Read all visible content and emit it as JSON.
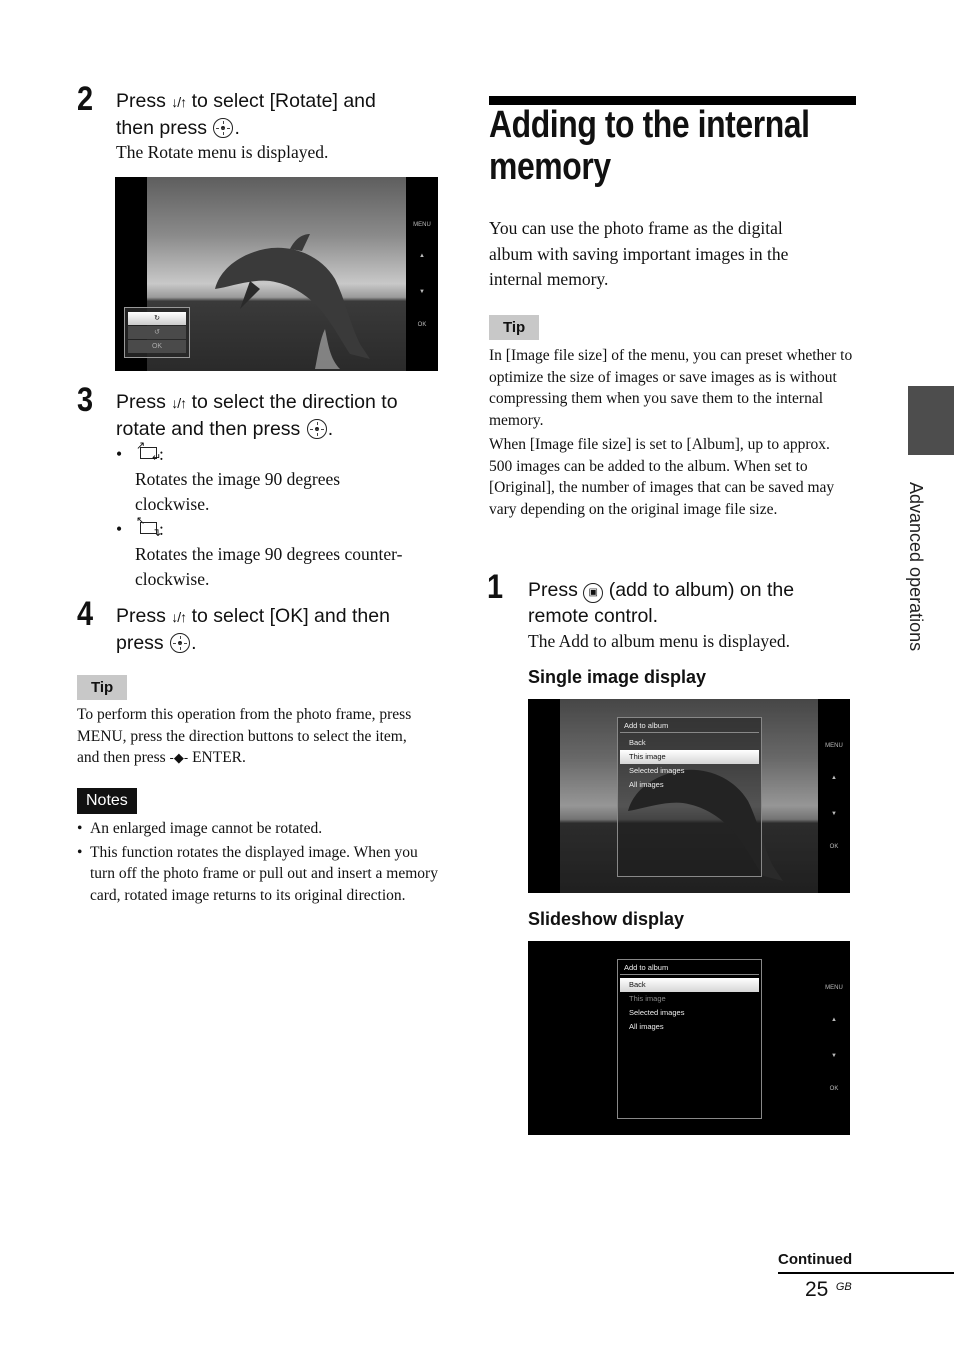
{
  "left_column": {
    "step2": {
      "number": "2",
      "text_before": "Press",
      "arrows": "↓/↑",
      "text_middle": "to select [Rotate] and",
      "line2": "then press",
      "suffix": ".",
      "desc": "The Rotate menu is displayed."
    },
    "rotate_screen": {
      "menu_items": [
        "",
        "",
        "OK"
      ],
      "side_controls": [
        "MENU",
        "▲",
        "▼",
        "OK"
      ]
    },
    "step3": {
      "number": "3",
      "text_before": "Press",
      "arrows": "↓/↑",
      "text_middle": "to select the direction to",
      "line2": "rotate and then press",
      "suffix": ".",
      "bullets": [
        {
          "icon": "rotate-clockwise",
          "colon": ":",
          "desc1": "Rotates the image 90 degrees",
          "desc2": "clockwise."
        },
        {
          "icon": "rotate-counterclockwise",
          "colon": ":",
          "desc1": "Rotates the image 90 degrees counter-",
          "desc2": "clockwise."
        }
      ]
    },
    "step4": {
      "number": "4",
      "text_before": "Press",
      "arrows": "↓/↑",
      "text_middle": "to select [OK] and then",
      "line2": "press",
      "suffix": "."
    },
    "tip": {
      "label": "Tip",
      "line1": "To perform this operation from the photo frame, press",
      "line2": "MENU, press the direction buttons to select the item,",
      "line3_before": "and then press",
      "line3_after": "ENTER."
    },
    "notes": {
      "label": "Notes",
      "items": [
        "An enlarged image cannot be rotated.",
        "This function rotates the displayed image. When you turn off the photo frame or pull out and insert a memory card, rotated image returns to its original direction."
      ]
    }
  },
  "right_column": {
    "heading_line1": "Adding to the internal",
    "heading_line2": "memory",
    "intro": "You can use the photo frame as the digital album with saving important images in the internal memory.",
    "tip": {
      "label": "Tip",
      "para1": "In [Image file size] of the menu, you can preset whether to optimize the size of images or save images as is without compressing them when you save them to the internal memory.",
      "para2": "When [Image file size] is set to [Album], up to approx. 500 images can be added to the album. When set to [Original], the number of images that can be saved may vary depending on the original image file size."
    },
    "step1": {
      "number": "1",
      "text_before": "Press",
      "text_after": "(add to album) on the",
      "line2": "remote control.",
      "desc": "The Add to album menu is displayed."
    },
    "single_display": {
      "caption": "Single image display",
      "menu_title": "Add to album",
      "items": [
        "Back",
        "This image",
        "Selected images",
        "All images"
      ],
      "selected": "This image",
      "side_controls": [
        "MENU",
        "▲",
        "▼",
        "OK"
      ]
    },
    "slideshow_display": {
      "caption": "Slideshow display",
      "menu_title": "Add to album",
      "items": [
        "Back",
        "This image",
        "Selected images",
        "All images"
      ],
      "selected": "Back",
      "disabled": "This image",
      "side_controls": [
        "MENU",
        "▲",
        "▼",
        "OK"
      ]
    }
  },
  "sidebar": {
    "section_label": "Advanced operations"
  },
  "footer": {
    "continued": "Continued",
    "page_number": "25",
    "page_suffix": "GB"
  }
}
